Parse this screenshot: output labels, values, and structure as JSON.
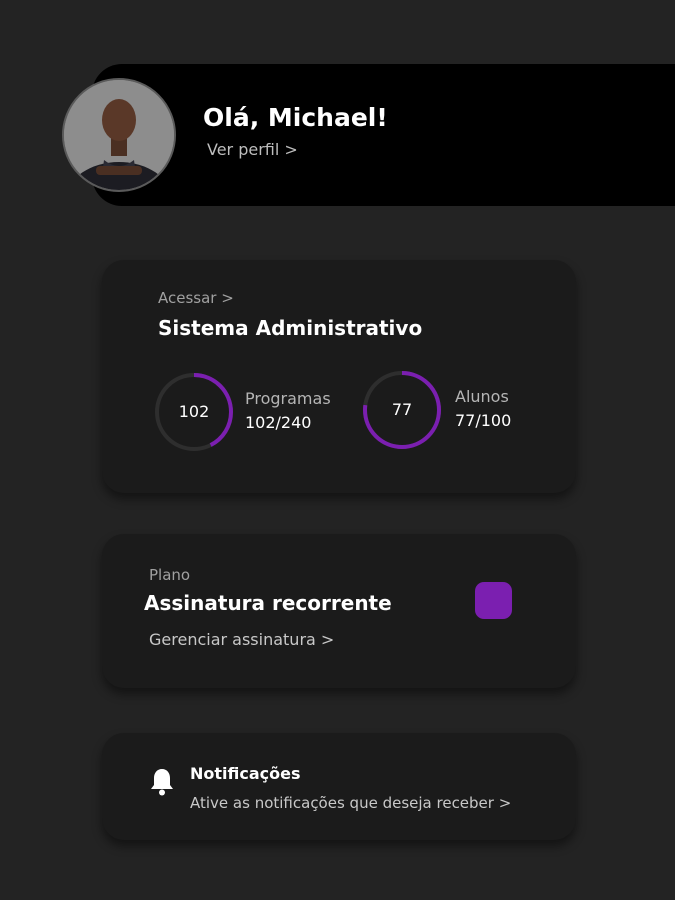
{
  "profile": {
    "greeting": "Olá, Michael!",
    "view_profile": "Ver perfil >"
  },
  "admin": {
    "access_label": "Acessar >",
    "title": "Sistema Administrativo",
    "stats": [
      {
        "value": "102",
        "label": "Programas",
        "count": "102/240",
        "fraction": 0.425
      },
      {
        "value": "77",
        "label": "Alunos",
        "count": "77/100",
        "fraction": 0.77
      }
    ]
  },
  "plan": {
    "label": "Plano",
    "title": "Assinatura recorrente",
    "manage": "Gerenciar assinatura >"
  },
  "notifications": {
    "title": "Notificações",
    "description": "Ative as notificações que deseja receber >"
  },
  "colors": {
    "background": "#232323",
    "header": "#000000",
    "card": "#1b1b1b",
    "accent": "#7b1fb0"
  },
  "icons": {
    "notifications": "bell-icon"
  }
}
